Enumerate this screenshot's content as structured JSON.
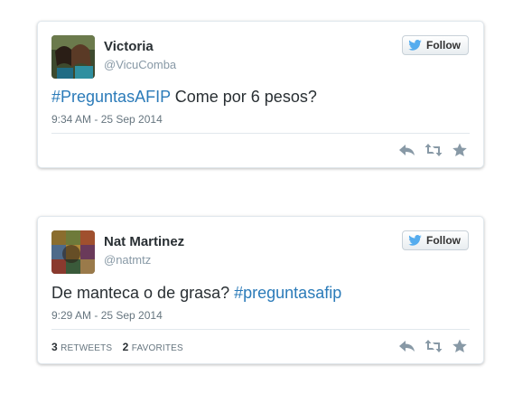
{
  "tweets": [
    {
      "name": "Victoria",
      "handle": "@VicuComba",
      "follow_label": "Follow",
      "text_parts": [
        {
          "text": "#PreguntasAFIP",
          "hashtag": true
        },
        {
          "text": " Come por 6 pesos?",
          "hashtag": false
        }
      ],
      "timestamp": "9:34 AM - 25 Sep 2014"
    },
    {
      "name": "Nat Martinez",
      "handle": "@natmtz",
      "follow_label": "Follow",
      "text_parts": [
        {
          "text": "De manteca o de grasa? ",
          "hashtag": false
        },
        {
          "text": "#preguntasafip",
          "hashtag": true
        }
      ],
      "timestamp": "9:29 AM - 25 Sep 2014",
      "retweets_count": "3",
      "retweets_label": "Retweets",
      "favorites_count": "2",
      "favorites_label": "Favorites"
    }
  ],
  "colors": {
    "hashtag": "#2b7bb9",
    "twitter_bird": "#55acee",
    "action_icon": "#8899a6"
  },
  "icons": {
    "follow": "twitter-bird-icon",
    "reply": "reply-icon",
    "retweet": "retweet-icon",
    "favorite": "star-icon"
  }
}
